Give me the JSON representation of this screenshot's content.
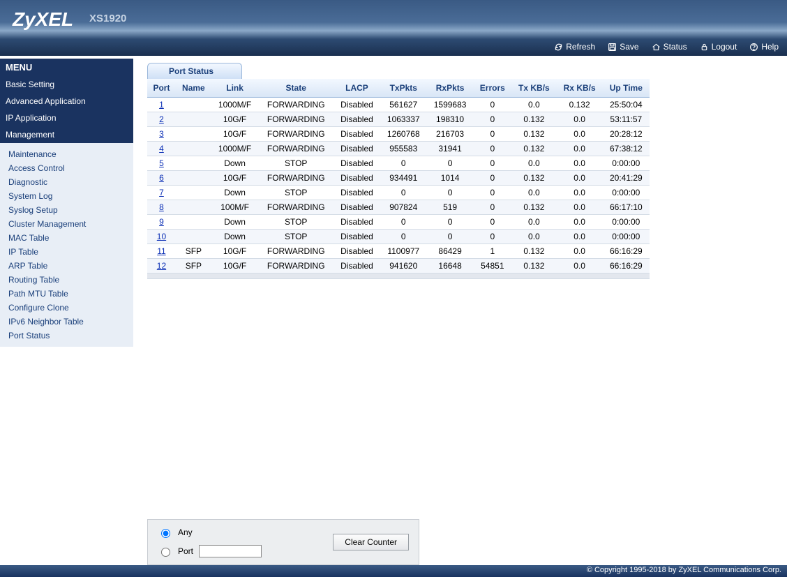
{
  "brand": "ZyXEL",
  "model": "XS1920",
  "top_actions": {
    "refresh": "Refresh",
    "save": "Save",
    "status": "Status",
    "logout": "Logout",
    "help": "Help"
  },
  "menu": {
    "header": "MENU",
    "top": [
      "Basic Setting",
      "Advanced Application",
      "IP Application",
      "Management"
    ],
    "sub": [
      "Maintenance",
      "Access Control",
      "Diagnostic",
      "System Log",
      "Syslog Setup",
      "Cluster Management",
      "MAC Table",
      "IP Table",
      "ARP Table",
      "Routing Table",
      "Path MTU Table",
      "Configure Clone",
      "IPv6 Neighbor Table",
      "Port Status"
    ]
  },
  "panel_title": "Port Status",
  "columns": [
    "Port",
    "Name",
    "Link",
    "State",
    "LACP",
    "TxPkts",
    "RxPkts",
    "Errors",
    "Tx KB/s",
    "Rx KB/s",
    "Up Time"
  ],
  "rows": [
    {
      "port": "1",
      "name": "",
      "link": "1000M/F",
      "state": "FORWARDING",
      "lacp": "Disabled",
      "tx": "561627",
      "rx": "1599683",
      "err": "0",
      "txkb": "0.0",
      "rxkb": "0.132",
      "up": "25:50:04"
    },
    {
      "port": "2",
      "name": "",
      "link": "10G/F",
      "state": "FORWARDING",
      "lacp": "Disabled",
      "tx": "1063337",
      "rx": "198310",
      "err": "0",
      "txkb": "0.132",
      "rxkb": "0.0",
      "up": "53:11:57"
    },
    {
      "port": "3",
      "name": "",
      "link": "10G/F",
      "state": "FORWARDING",
      "lacp": "Disabled",
      "tx": "1260768",
      "rx": "216703",
      "err": "0",
      "txkb": "0.132",
      "rxkb": "0.0",
      "up": "20:28:12"
    },
    {
      "port": "4",
      "name": "",
      "link": "1000M/F",
      "state": "FORWARDING",
      "lacp": "Disabled",
      "tx": "955583",
      "rx": "31941",
      "err": "0",
      "txkb": "0.132",
      "rxkb": "0.0",
      "up": "67:38:12"
    },
    {
      "port": "5",
      "name": "",
      "link": "Down",
      "state": "STOP",
      "lacp": "Disabled",
      "tx": "0",
      "rx": "0",
      "err": "0",
      "txkb": "0.0",
      "rxkb": "0.0",
      "up": "0:00:00"
    },
    {
      "port": "6",
      "name": "",
      "link": "10G/F",
      "state": "FORWARDING",
      "lacp": "Disabled",
      "tx": "934491",
      "rx": "1014",
      "err": "0",
      "txkb": "0.132",
      "rxkb": "0.0",
      "up": "20:41:29"
    },
    {
      "port": "7",
      "name": "",
      "link": "Down",
      "state": "STOP",
      "lacp": "Disabled",
      "tx": "0",
      "rx": "0",
      "err": "0",
      "txkb": "0.0",
      "rxkb": "0.0",
      "up": "0:00:00"
    },
    {
      "port": "8",
      "name": "",
      "link": "100M/F",
      "state": "FORWARDING",
      "lacp": "Disabled",
      "tx": "907824",
      "rx": "519",
      "err": "0",
      "txkb": "0.132",
      "rxkb": "0.0",
      "up": "66:17:10"
    },
    {
      "port": "9",
      "name": "",
      "link": "Down",
      "state": "STOP",
      "lacp": "Disabled",
      "tx": "0",
      "rx": "0",
      "err": "0",
      "txkb": "0.0",
      "rxkb": "0.0",
      "up": "0:00:00"
    },
    {
      "port": "10",
      "name": "",
      "link": "Down",
      "state": "STOP",
      "lacp": "Disabled",
      "tx": "0",
      "rx": "0",
      "err": "0",
      "txkb": "0.0",
      "rxkb": "0.0",
      "up": "0:00:00"
    },
    {
      "port": "11",
      "name": "SFP",
      "link": "10G/F",
      "state": "FORWARDING",
      "lacp": "Disabled",
      "tx": "1100977",
      "rx": "86429",
      "err": "1",
      "txkb": "0.132",
      "rxkb": "0.0",
      "up": "66:16:29"
    },
    {
      "port": "12",
      "name": "SFP",
      "link": "10G/F",
      "state": "FORWARDING",
      "lacp": "Disabled",
      "tx": "941620",
      "rx": "16648",
      "err": "54851",
      "txkb": "0.132",
      "rxkb": "0.0",
      "up": "66:16:29"
    }
  ],
  "counter": {
    "any": "Any",
    "port": "Port",
    "clear": "Clear Counter"
  },
  "footer": "© Copyright 1995-2018 by ZyXEL Communications Corp."
}
